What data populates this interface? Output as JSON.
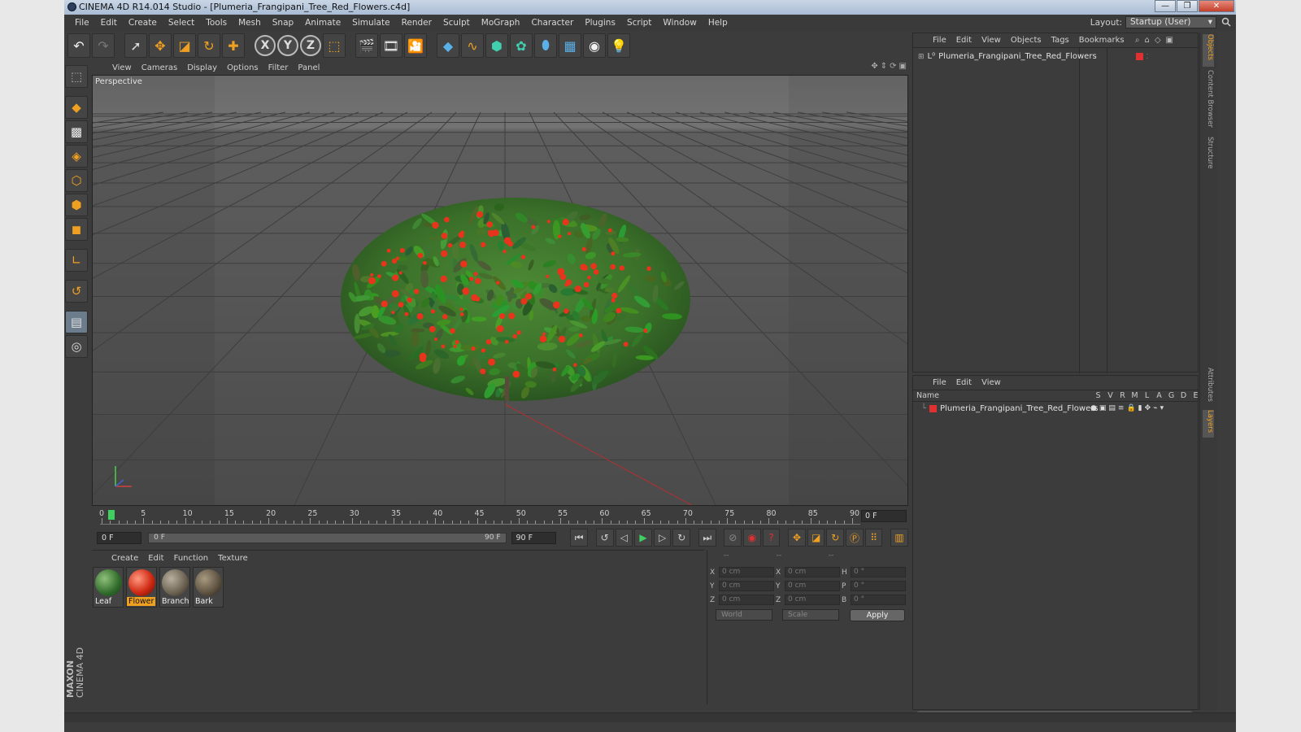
{
  "window": {
    "title": "CINEMA 4D R14.014 Studio - [Plumeria_Frangipani_Tree_Red_Flowers.c4d]"
  },
  "menubar": [
    "File",
    "Edit",
    "Create",
    "Select",
    "Tools",
    "Mesh",
    "Snap",
    "Animate",
    "Simulate",
    "Render",
    "Sculpt",
    "MoGraph",
    "Character",
    "Plugins",
    "Script",
    "Window",
    "Help"
  ],
  "layout": {
    "label": "Layout:",
    "value": "Startup (User)"
  },
  "viewport": {
    "menu": [
      "View",
      "Cameras",
      "Display",
      "Options",
      "Filter",
      "Panel"
    ],
    "label": "Perspective"
  },
  "timeline": {
    "ticks": [
      "0",
      "5",
      "10",
      "15",
      "20",
      "25",
      "30",
      "35",
      "40",
      "45",
      "50",
      "55",
      "60",
      "65",
      "70",
      "75",
      "80",
      "85",
      "90"
    ],
    "current_frame": "0 F",
    "start_field": "0 F",
    "range_start": "0 F",
    "range_end": "90 F",
    "end_field": "90 F"
  },
  "materials": {
    "menu": [
      "Create",
      "Edit",
      "Function",
      "Texture"
    ],
    "items": [
      {
        "label": "Leaf",
        "selected": false
      },
      {
        "label": "Flower",
        "selected": true
      },
      {
        "label": "Branch",
        "selected": false
      },
      {
        "label": "Bark",
        "selected": false
      }
    ]
  },
  "coordinates": {
    "header": [
      "--",
      "--",
      "--"
    ],
    "rows": [
      {
        "l1": "X",
        "v1": "0 cm",
        "l2": "X",
        "v2": "0 cm",
        "l3": "H",
        "v3": "0 °"
      },
      {
        "l1": "Y",
        "v1": "0 cm",
        "l2": "Y",
        "v2": "0 cm",
        "l3": "P",
        "v3": "0 °"
      },
      {
        "l1": "Z",
        "v1": "0 cm",
        "l2": "Z",
        "v2": "0 cm",
        "l3": "B",
        "v3": "0 °"
      }
    ],
    "world_dropdown": "World",
    "scale_dropdown": "Scale",
    "apply_label": "Apply"
  },
  "object_manager": {
    "menu": [
      "File",
      "Edit",
      "View",
      "Objects",
      "Tags",
      "Bookmarks"
    ],
    "object_name": "Plumeria_Frangipani_Tree_Red_Flowers"
  },
  "layer_manager": {
    "menu": [
      "File",
      "Edit",
      "View"
    ],
    "header_name": "Name",
    "columns": [
      "S",
      "V",
      "R",
      "M",
      "L",
      "A",
      "G",
      "D",
      "E"
    ],
    "layer_name": "Plumeria_Frangipani_Tree_Red_Flowers"
  },
  "side_tabs": [
    "Objects",
    "Content Browser",
    "Structure",
    "Attributes",
    "Layers"
  ],
  "brand": {
    "line1": "MAXON",
    "line2": "CINEMA 4D"
  },
  "colors": {
    "accent": "#f0a020",
    "flower_red": "#e8341c",
    "leaf_green": "#3d7a2c",
    "playhead": "#3fd060"
  }
}
